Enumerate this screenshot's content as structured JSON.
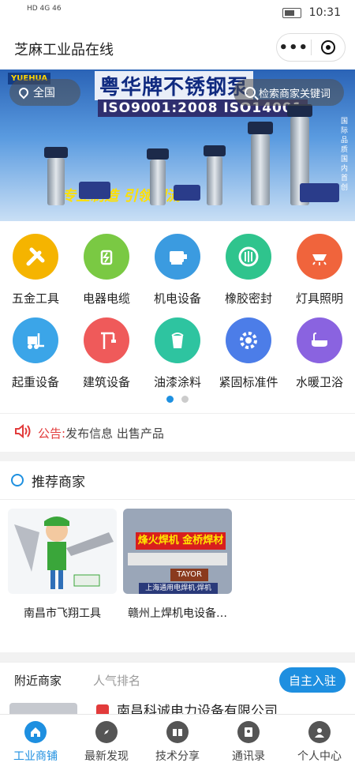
{
  "status": {
    "left_text": "HD  4G  46",
    "time": "10:31"
  },
  "nav": {
    "title": "芝麻工业品在线",
    "more_icon": "ellipsis-icon",
    "close_icon": "target-close-icon"
  },
  "banner": {
    "brand": "YUEHUA",
    "headline": "粤华牌不锈钢泵",
    "iso": "ISO9001:2008  ISO14001",
    "slogan": "专业制造 引领潮流",
    "side_text": "国际品质 国内首创"
  },
  "location": {
    "label": "全国"
  },
  "search": {
    "placeholder": "检索商家关键词"
  },
  "categories": [
    {
      "label": "五金工具",
      "icon": "tools-icon",
      "color": "#f5b400"
    },
    {
      "label": "电器电缆",
      "icon": "plug-icon",
      "color": "#7ac943"
    },
    {
      "label": "机电设备",
      "icon": "motor-icon",
      "color": "#3b9be0"
    },
    {
      "label": "橡胶密封",
      "icon": "seal-icon",
      "color": "#2fc48d"
    },
    {
      "label": "灯具照明",
      "icon": "lamp-icon",
      "color": "#f0643c"
    },
    {
      "label": "起重设备",
      "icon": "forklift-icon",
      "color": "#3ba5e8"
    },
    {
      "label": "建筑设备",
      "icon": "crane-icon",
      "color": "#ef5a5a"
    },
    {
      "label": "油漆涂料",
      "icon": "paint-bucket-icon",
      "color": "#2ec4a0"
    },
    {
      "label": "紧固标准件",
      "icon": "gear-icon",
      "color": "#4c7de8"
    },
    {
      "label": "水暖卫浴",
      "icon": "bathtub-icon",
      "color": "#8a63e0"
    }
  ],
  "notice": {
    "tag": "公告:",
    "text": "发布信息 出售产品"
  },
  "recommended": {
    "title": "推荐商家",
    "merchants": [
      {
        "name": "南昌市飞翔工具"
      },
      {
        "name": "赣州上焊机电设备…",
        "sign": "烽火焊机 金桥焊材",
        "sign2": "TAYOR",
        "sign3": "上海通用电焊机·焊机"
      }
    ]
  },
  "nearby": {
    "tabs": [
      "附近商家",
      "人气排名"
    ],
    "join_button": "自主入驻",
    "first_item": "南昌科诚电力设备有限公司"
  },
  "tabbar": [
    {
      "label": "工业商铺",
      "icon": "home-icon",
      "active": true
    },
    {
      "label": "最新发现",
      "icon": "compass-icon",
      "active": false
    },
    {
      "label": "技术分享",
      "icon": "book-icon",
      "active": false
    },
    {
      "label": "通讯录",
      "icon": "contacts-icon",
      "active": false
    },
    {
      "label": "个人中心",
      "icon": "user-icon",
      "active": false
    }
  ]
}
